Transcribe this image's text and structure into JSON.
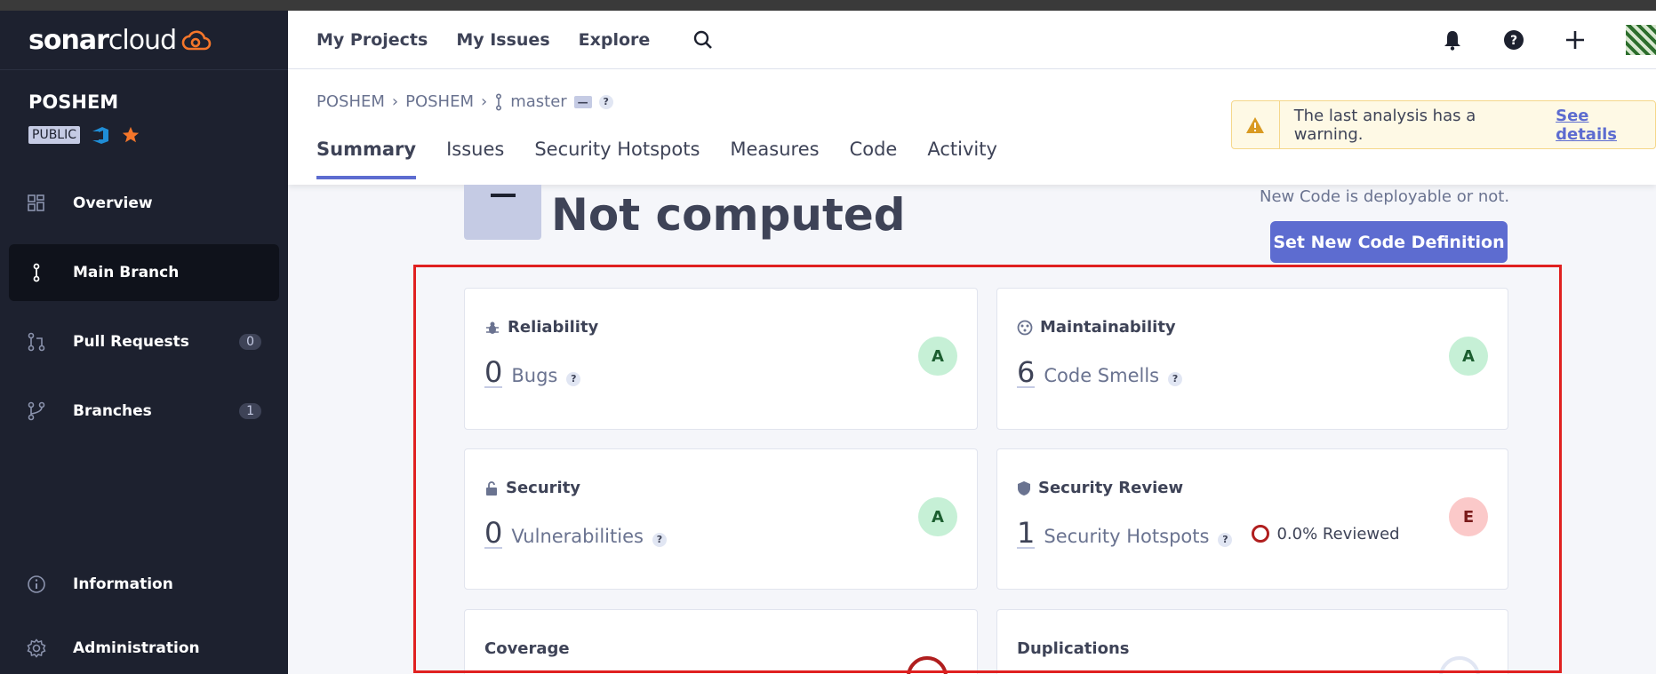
{
  "app": {
    "logo_text_bold": "sonar",
    "logo_text_light": "cloud"
  },
  "project": {
    "name": "POSHEM",
    "visibility": "PUBLIC"
  },
  "sidebar": {
    "items": [
      {
        "label": "Overview",
        "icon": "dashboard-icon"
      },
      {
        "label": "Main Branch",
        "icon": "branch-icon",
        "active": true
      },
      {
        "label": "Pull Requests",
        "icon": "pull-request-icon",
        "count": "0"
      },
      {
        "label": "Branches",
        "icon": "branches-icon",
        "count": "1"
      }
    ],
    "bottom": [
      {
        "label": "Information",
        "icon": "info-icon"
      },
      {
        "label": "Administration",
        "icon": "gear-icon"
      }
    ]
  },
  "header": {
    "links": [
      "My Projects",
      "My Issues",
      "Explore"
    ]
  },
  "breadcrumb": {
    "org": "POSHEM",
    "project": "POSHEM",
    "branch": "master",
    "badge": "—",
    "help": "?"
  },
  "tabs": [
    "Summary",
    "Issues",
    "Security Hotspots",
    "Measures",
    "Code",
    "Activity"
  ],
  "warning": {
    "text": "The last analysis has a warning.",
    "link": "See details"
  },
  "quality_gate": {
    "status": "Not computed"
  },
  "new_code": {
    "hint": "New Code is deployable or not.",
    "button": "Set New Code Definition"
  },
  "cards": {
    "reliability": {
      "title": "Reliability",
      "value": "0",
      "metric": "Bugs",
      "rating": "A"
    },
    "maintainability": {
      "title": "Maintainability",
      "value": "6",
      "metric": "Code Smells",
      "rating": "A"
    },
    "security": {
      "title": "Security",
      "value": "0",
      "metric": "Vulnerabilities",
      "rating": "A"
    },
    "security_review": {
      "title": "Security Review",
      "value": "1",
      "metric": "Security Hotspots",
      "reviewed": "0.0% Reviewed",
      "rating": "E"
    },
    "coverage": {
      "title": "Coverage"
    },
    "duplications": {
      "title": "Duplications"
    }
  },
  "colors": {
    "sidebar_bg": "#1d212f",
    "accent": "#5d6cd0",
    "rating_a": "#c6f0d6",
    "rating_e": "#fbc9c9",
    "highlight": "#e02020"
  }
}
